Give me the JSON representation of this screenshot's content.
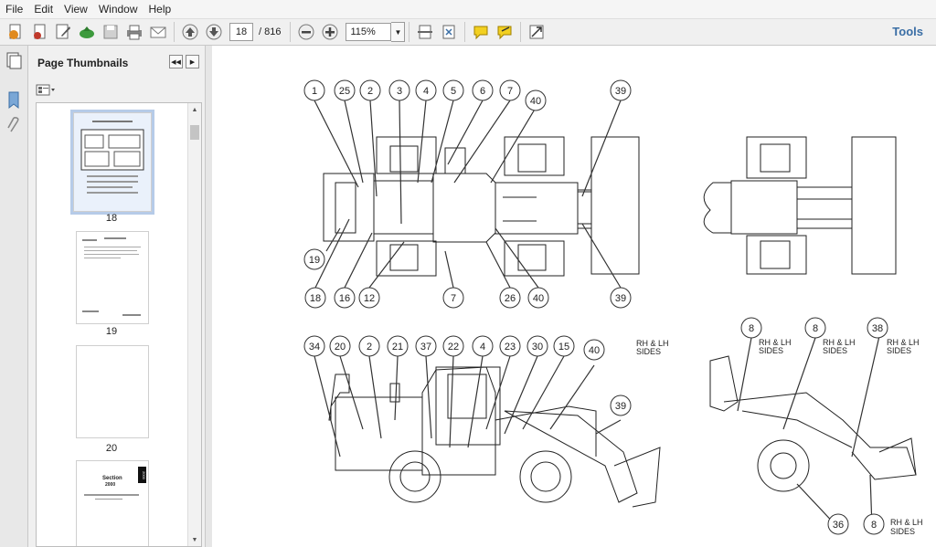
{
  "menu": [
    "File",
    "Edit",
    "View",
    "Window",
    "Help"
  ],
  "toolbar": {
    "page_current": "18",
    "page_total": "/ 816",
    "zoom": "115%",
    "tools_label": "Tools"
  },
  "panel": {
    "title": "Page Thumbnails",
    "thumbs": [
      {
        "label": "18",
        "selected": true
      },
      {
        "label": "19",
        "selected": false
      },
      {
        "label": "20",
        "selected": false
      },
      {
        "label": "",
        "selected": false
      }
    ],
    "section_thumb_title": "Section",
    "section_thumb_number": "2000",
    "section_thumb_tab": "2000"
  },
  "drawing": {
    "top_callouts": [
      "1",
      "25",
      "2",
      "3",
      "4",
      "5",
      "6",
      "7",
      "40",
      "39"
    ],
    "left_callout": "19",
    "bottom_callouts": [
      "18",
      "16",
      "12",
      "7",
      "26",
      "40",
      "39"
    ],
    "side_callouts": [
      "34",
      "20",
      "2",
      "21",
      "37",
      "22",
      "4",
      "23",
      "30",
      "15",
      "40",
      "39"
    ],
    "right_callouts": [
      "8",
      "8",
      "38",
      "36",
      "8"
    ],
    "rh_lh_label_1": "RH & LH",
    "rh_lh_label_2": "SIDES"
  }
}
